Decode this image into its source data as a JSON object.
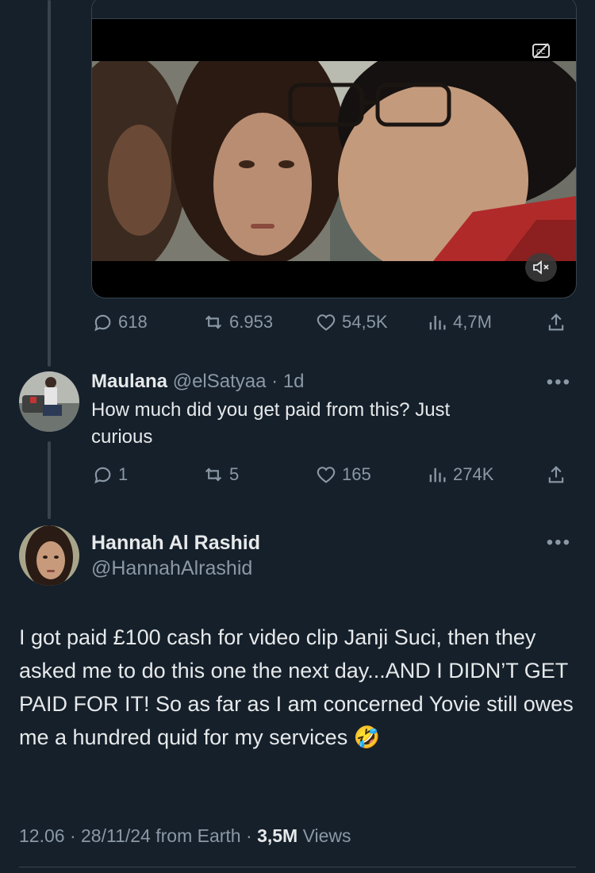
{
  "video": {
    "stats": {
      "replies": "618",
      "reposts": "6.953",
      "likes": "54,5K",
      "views": "4,7M"
    }
  },
  "reply": {
    "name": "Maulana",
    "handle": "@elSatyaa",
    "separator": "·",
    "time": "1d",
    "text": "How much did you get paid from this? Just curious",
    "stats": {
      "replies": "1",
      "reposts": "5",
      "likes": "165",
      "views": "274K"
    }
  },
  "post": {
    "name": "Hannah Al Rashid",
    "handle": "@HannahAlrashid",
    "text": "I got paid £100 cash for video clip Janji Suci, then they asked me to do this one the next day...AND I DIDN’T GET PAID FOR IT! So as far as I am concerned Yovie still owes me a hundred quid for my services 🤣",
    "time": "12.06",
    "date": "28/11/24",
    "from": "from Earth",
    "views_count": "3,5M",
    "views_label": "Views",
    "dot": "·"
  },
  "more_glyph": "•••"
}
